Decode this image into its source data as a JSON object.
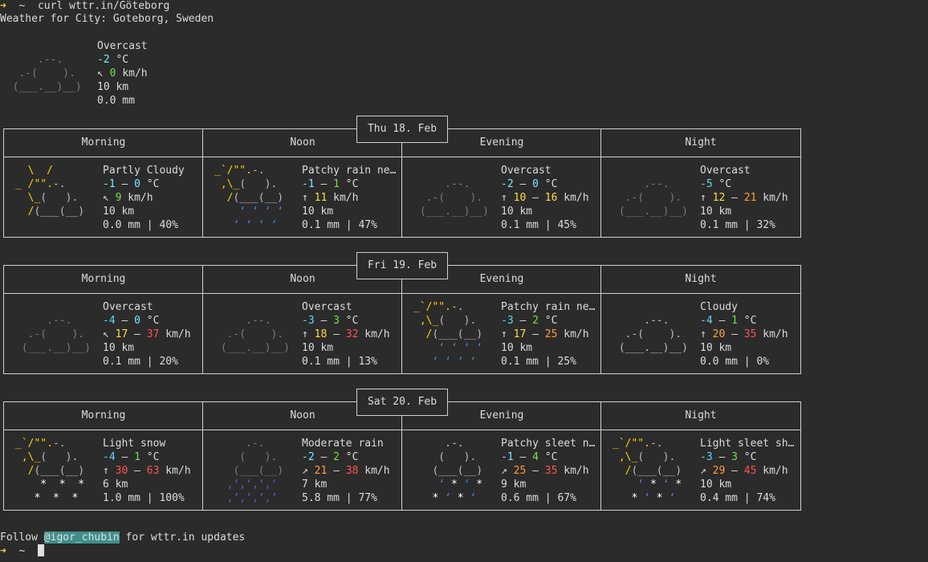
{
  "terminal": {
    "prompt_symbol": "➜",
    "prompt_dir": "~",
    "command": "curl wttr.in/Göteborg",
    "header": "Weather for City: Goteborg, Sweden",
    "footer_follow": "Follow ",
    "footer_handle": "@igor_chubin",
    "footer_rest": " for wttr.in updates"
  },
  "current": {
    "condition": "Overcast",
    "temp": "-2",
    "temp_unit": "°C",
    "wind_arrow": "↖",
    "wind": "0",
    "wind_unit": "km/h",
    "visibility": "10 km",
    "precip": "0.0 mm"
  },
  "columns": [
    "Morning",
    "Noon",
    "Evening",
    "Night"
  ],
  "days": [
    {
      "label": "Thu 18. Feb",
      "periods": [
        {
          "condition": "Partly Cloudy",
          "t1": "-1",
          "t2": "0",
          "wind_arrow": "↖",
          "w1": "9",
          "w2": "",
          "vis": "10 km",
          "precip": "0.0 mm | 40%"
        },
        {
          "condition": "Patchy rain ne…",
          "t1": "-1",
          "t2": "1",
          "wind_arrow": "↑",
          "w1": "11",
          "w2": "",
          "vis": "10 km",
          "precip": "0.1 mm | 47%"
        },
        {
          "condition": "Overcast",
          "t1": "-2",
          "t2": "0",
          "wind_arrow": "↑",
          "w1": "10",
          "w2": "16",
          "vis": "10 km",
          "precip": "0.1 mm | 45%"
        },
        {
          "condition": "Overcast",
          "t1": "-5",
          "t2": "",
          "wind_arrow": "↑",
          "w1": "12",
          "w2": "21",
          "vis": "10 km",
          "precip": "0.1 mm | 32%"
        }
      ]
    },
    {
      "label": "Fri 19. Feb",
      "periods": [
        {
          "condition": "Overcast",
          "t1": "-4",
          "t2": "0",
          "wind_arrow": "↖",
          "w1": "17",
          "w2": "37",
          "vis": "10 km",
          "precip": "0.1 mm | 20%"
        },
        {
          "condition": "Overcast",
          "t1": "-3",
          "t2": "3",
          "wind_arrow": "↑",
          "w1": "18",
          "w2": "32",
          "vis": "10 km",
          "precip": "0.1 mm | 13%"
        },
        {
          "condition": "Patchy rain ne…",
          "t1": "-3",
          "t2": "2",
          "wind_arrow": "↑",
          "w1": "17",
          "w2": "25",
          "vis": "10 km",
          "precip": "0.1 mm | 25%"
        },
        {
          "condition": "Cloudy",
          "t1": "-4",
          "t2": "1",
          "wind_arrow": "↑",
          "w1": "20",
          "w2": "35",
          "vis": "10 km",
          "precip": "0.0 mm | 0%"
        }
      ]
    },
    {
      "label": "Sat 20. Feb",
      "periods": [
        {
          "condition": "Light snow",
          "t1": "-4",
          "t2": "1",
          "wind_arrow": "↑",
          "w1": "30",
          "w2": "63",
          "vis": "6 km",
          "precip": "1.0 mm | 100%"
        },
        {
          "condition": "Moderate rain",
          "t1": "-2",
          "t2": "2",
          "wind_arrow": "↗",
          "w1": "21",
          "w2": "38",
          "vis": "7 km",
          "precip": "5.8 mm | 77%"
        },
        {
          "condition": "Patchy sleet n…",
          "t1": "-1",
          "t2": "4",
          "wind_arrow": "↗",
          "w1": "25",
          "w2": "35",
          "vis": "9 km",
          "precip": "0.6 mm | 67%"
        },
        {
          "condition": "Light sleet sh…",
          "t1": "-3",
          "t2": "3",
          "wind_arrow": "↗",
          "w1": "29",
          "w2": "45",
          "vis": "10 km",
          "precip": "0.4 mm | 74%"
        }
      ]
    }
  ]
}
